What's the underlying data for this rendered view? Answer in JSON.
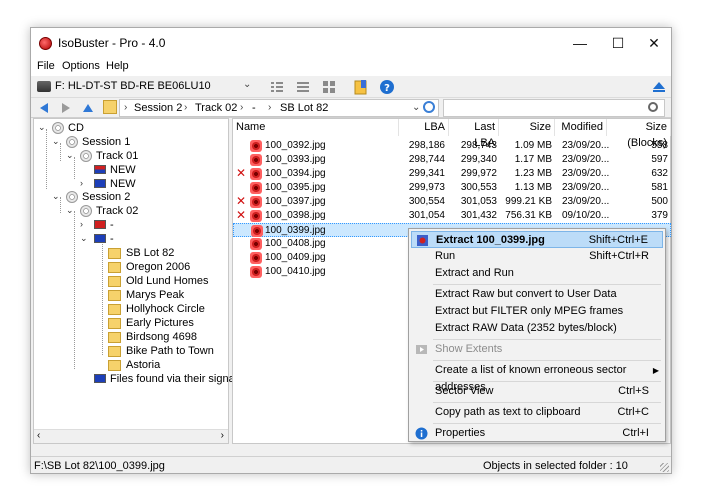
{
  "window": {
    "title": "IsoBuster - Pro - 4.0"
  },
  "window_controls": {
    "minimize": "—",
    "maximize": "☐",
    "close": "✕"
  },
  "menu": [
    "File",
    "Options",
    "Help"
  ],
  "drive": {
    "selected": "F: HL-DT-ST  BD-RE  BE06LU10"
  },
  "breadcrumbs": [
    "Session 2",
    "Track 02",
    "-",
    "SB Lot 82"
  ],
  "search": {
    "placeholder": ""
  },
  "tree": {
    "root": "CD",
    "session1": "Session 1",
    "track01": "Track 01",
    "new1": "NEW",
    "new2": "NEW",
    "session2": "Session 2",
    "track02": "Track 02",
    "iso": "-",
    "udf": "-",
    "folders": [
      "SB Lot 82",
      "Oregon 2006",
      "Old Lund Homes",
      "Marys Peak",
      "Hollyhock Circle",
      "Early Pictures",
      "Birdsong 4698",
      "Bike Path to Town",
      "Astoria"
    ],
    "signature": "Files found via their signature"
  },
  "columns": [
    "Name",
    "LBA",
    "Last LBA",
    "Size",
    "Modified",
    "Size (Blocks)"
  ],
  "files": [
    {
      "name": "100_0392.jpg",
      "lba": "298,186",
      "last": "298,743",
      "size": "1.09 MB",
      "mod": "23/09/20...",
      "blocks": "558",
      "error": false
    },
    {
      "name": "100_0393.jpg",
      "lba": "298,744",
      "last": "299,340",
      "size": "1.17 MB",
      "mod": "23/09/20...",
      "blocks": "597",
      "error": false
    },
    {
      "name": "100_0394.jpg",
      "lba": "299,341",
      "last": "299,972",
      "size": "1.23 MB",
      "mod": "23/09/20...",
      "blocks": "632",
      "error": true
    },
    {
      "name": "100_0395.jpg",
      "lba": "299,973",
      "last": "300,553",
      "size": "1.13 MB",
      "mod": "23/09/20...",
      "blocks": "581",
      "error": false
    },
    {
      "name": "100_0397.jpg",
      "lba": "300,554",
      "last": "301,053",
      "size": "999.21 KB",
      "mod": "23/09/20...",
      "blocks": "500",
      "error": true
    },
    {
      "name": "100_0398.jpg",
      "lba": "301,054",
      "last": "301,432",
      "size": "756.31 KB",
      "mod": "09/10/20...",
      "blocks": "379",
      "error": true
    },
    {
      "name": "100_0399.jpg",
      "lba": "",
      "last": "",
      "size": "",
      "mod": "",
      "blocks": "",
      "error": false
    },
    {
      "name": "100_0408.jpg",
      "lba": "",
      "last": "",
      "size": "",
      "mod": "",
      "blocks": "",
      "error": false
    },
    {
      "name": "100_0409.jpg",
      "lba": "",
      "last": "",
      "size": "",
      "mod": "",
      "blocks": "",
      "error": false
    },
    {
      "name": "100_0410.jpg",
      "lba": "",
      "last": "",
      "size": "",
      "mod": "",
      "blocks": "",
      "error": false
    }
  ],
  "selected_index": 6,
  "context_menu": {
    "extract": {
      "label": "Extract 100_0399.jpg",
      "shortcut": "Shift+Ctrl+E"
    },
    "run": {
      "label": "Run",
      "shortcut": "Shift+Ctrl+R"
    },
    "extract_run": {
      "label": "Extract and Run"
    },
    "extract_raw_user": {
      "label": "Extract Raw but convert to User Data"
    },
    "extract_mpeg": {
      "label": "Extract but FILTER only MPEG frames"
    },
    "extract_raw": {
      "label": "Extract RAW Data (2352 bytes/block)"
    },
    "show_extents": {
      "label": "Show Extents"
    },
    "erroneous": {
      "label": "Create a list of known erroneous sector addresses"
    },
    "sector_view": {
      "label": "Sector View",
      "shortcut": "Ctrl+S"
    },
    "copy_path": {
      "label": "Copy path as text to clipboard",
      "shortcut": "Ctrl+C"
    },
    "properties": {
      "label": "Properties",
      "shortcut": "Ctrl+I"
    }
  },
  "status": {
    "path": "F:\\SB Lot 82\\100_0399.jpg",
    "objects": "Objects in selected folder : 10"
  }
}
